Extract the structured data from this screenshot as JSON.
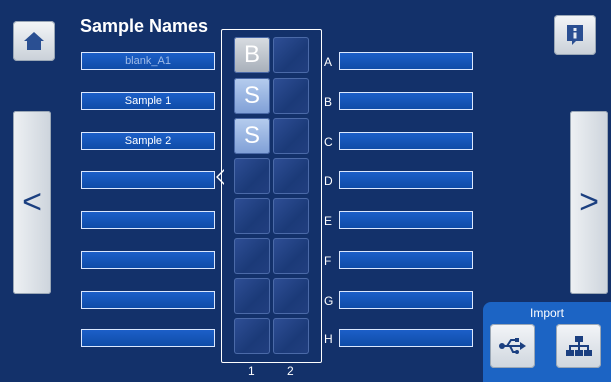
{
  "header": {
    "title": "Sample Names"
  },
  "left_fields": [
    "blank_A1",
    "Sample 1",
    "Sample 2",
    "",
    "",
    "",
    "",
    ""
  ],
  "right_fields": [
    "",
    "",
    "",
    "",
    "",
    "",
    "",
    ""
  ],
  "rows": [
    "A",
    "B",
    "C",
    "D",
    "E",
    "F",
    "G",
    "H"
  ],
  "columns": [
    "1",
    "2"
  ],
  "wells": {
    "A1": "B",
    "B1": "S",
    "C1": "S"
  },
  "nav": {
    "prev": "<",
    "next": ">"
  },
  "import": {
    "title": "Import",
    "usb_icon": "usb-icon",
    "network_icon": "network-icon"
  },
  "icons": {
    "home": "home-icon",
    "info": "info-icon"
  },
  "colors": {
    "background": "#13316a",
    "field": "#1c5fc8",
    "import_panel": "#1c64c4"
  }
}
